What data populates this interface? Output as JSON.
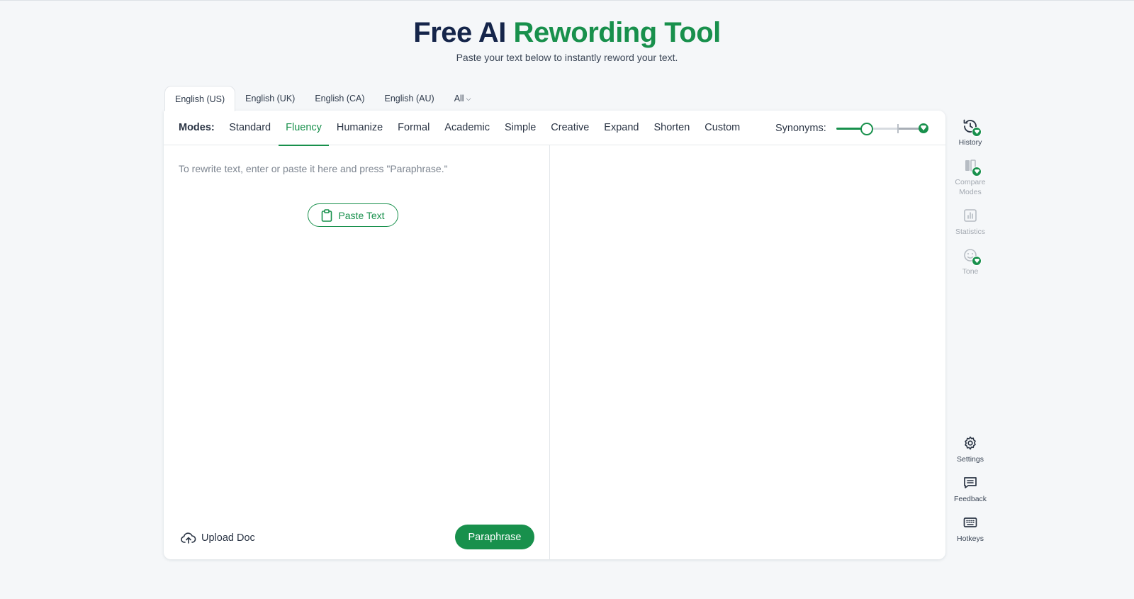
{
  "hero": {
    "title_part1": "Free AI",
    "title_part2": "Rewording Tool",
    "subtitle": "Paste your text below to instantly reword your text."
  },
  "language_tabs": [
    {
      "label": "English (US)",
      "active": true
    },
    {
      "label": "English (UK)",
      "active": false
    },
    {
      "label": "English (CA)",
      "active": false
    },
    {
      "label": "English (AU)",
      "active": false
    },
    {
      "label": "All",
      "active": false
    }
  ],
  "modes": {
    "label": "Modes:",
    "items": [
      "Standard",
      "Fluency",
      "Humanize",
      "Formal",
      "Academic",
      "Simple",
      "Creative",
      "Expand",
      "Shorten",
      "Custom"
    ],
    "active": "Fluency"
  },
  "synonyms": {
    "label": "Synonyms:",
    "level": 0.35
  },
  "editor": {
    "placeholder": "To rewrite text, enter or paste it here and press \"Paraphrase.\"",
    "paste_label": "Paste Text",
    "upload_label": "Upload Doc",
    "paraphrase_label": "Paraphrase"
  },
  "sidebar_top": [
    {
      "label": "History",
      "icon": "history-icon"
    },
    {
      "label": "Compare Modes",
      "icon": "compare-modes-icon"
    },
    {
      "label": "Statistics",
      "icon": "statistics-icon"
    },
    {
      "label": "Tone",
      "icon": "tone-icon"
    }
  ],
  "sidebar_bottom": [
    {
      "label": "Settings",
      "icon": "gear-icon"
    },
    {
      "label": "Feedback",
      "icon": "feedback-icon"
    },
    {
      "label": "Hotkeys",
      "icon": "keyboard-icon"
    }
  ],
  "colors": {
    "accent": "#18904c",
    "title": "#15254a",
    "background": "#f5f7f9"
  }
}
